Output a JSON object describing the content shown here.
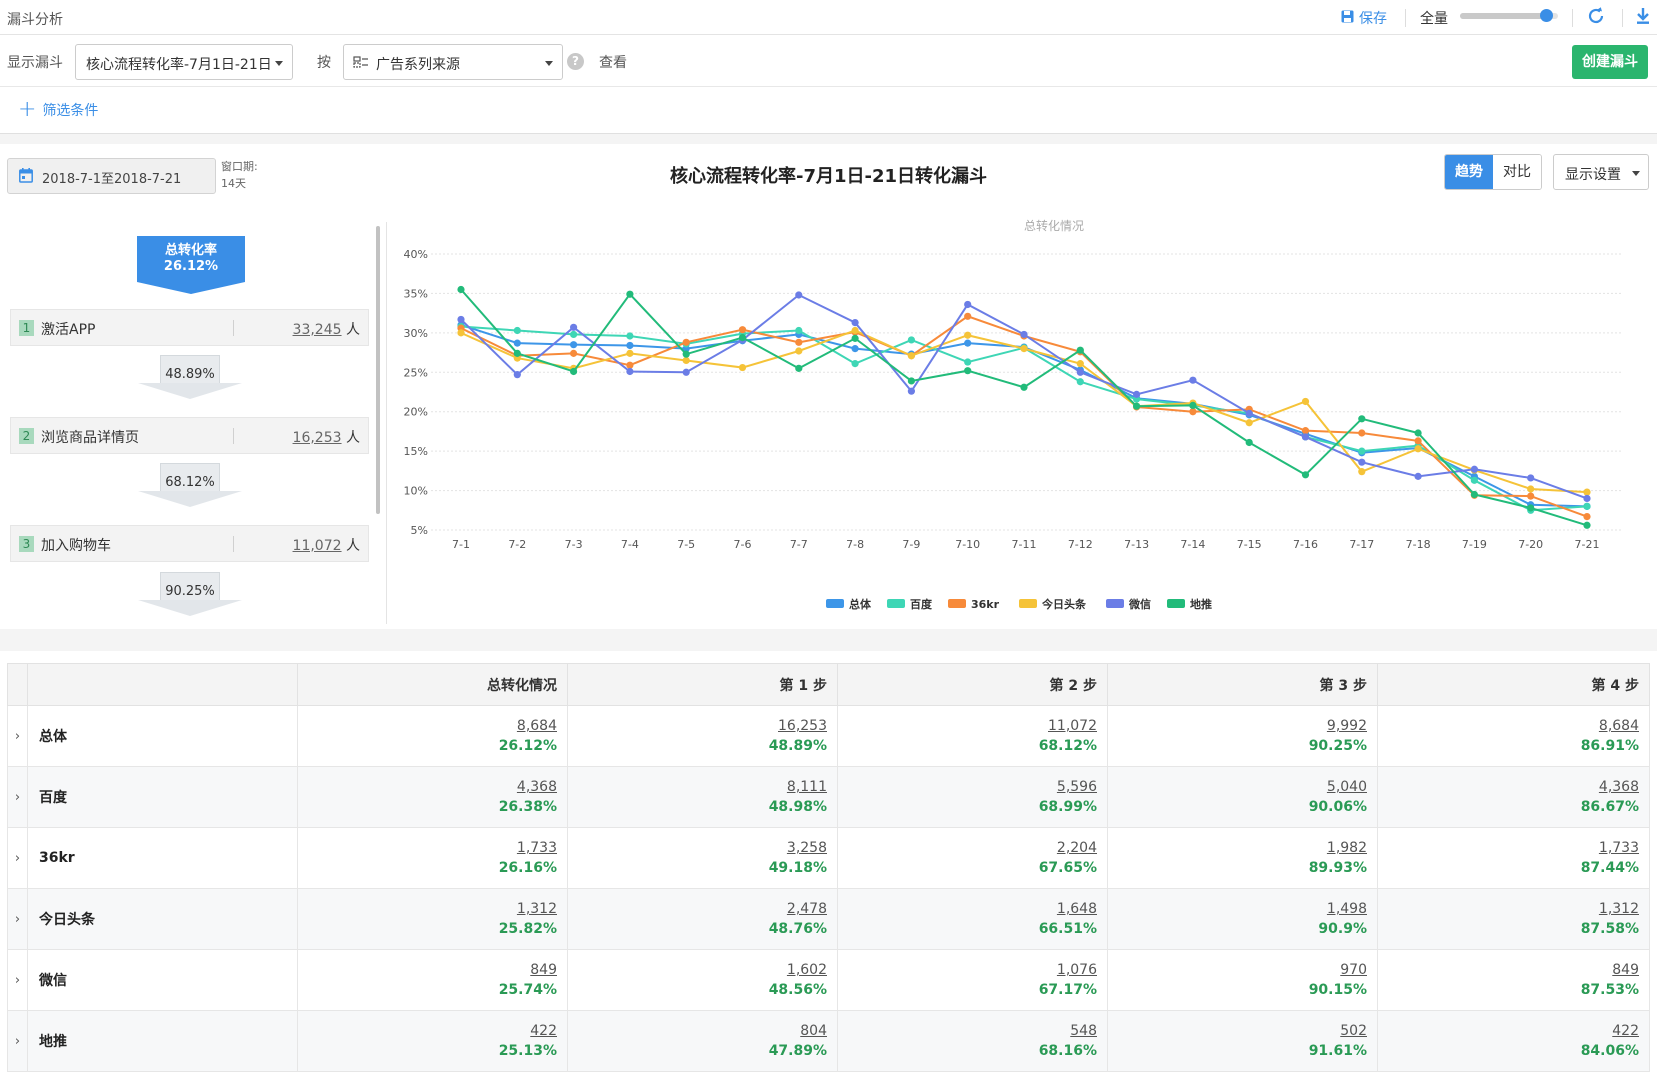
{
  "app": {
    "title": "漏斗分析",
    "save_label": "保存",
    "scope_label": "全量",
    "scope_level": 0.88
  },
  "controls": {
    "show_funnel_label": "显示漏斗",
    "funnel_select": "核心流程转化率-7月1日-21日",
    "by_label": "按",
    "group_select": "广告系列来源",
    "view_label": "查看",
    "create_button": "创建漏斗"
  },
  "filter": {
    "add_label": "筛选条件"
  },
  "panel": {
    "date_range": "2018-7-1至2018-7-21",
    "window_label": "窗口期:",
    "window_value": "14天",
    "title": "核心流程转化率-7月1日-21日转化漏斗",
    "view_tabs": [
      "趋势",
      "对比"
    ],
    "active_tab": "趋势",
    "display_settings": "显示设置"
  },
  "funnel": {
    "total_label": "总转化率",
    "total_value": "26.12%",
    "steps": [
      {
        "num": "1",
        "name": "激活APP",
        "count": "33,245",
        "unit": "人"
      },
      {
        "num": "2",
        "name": "浏览商品详情页",
        "count": "16,253",
        "unit": "人"
      },
      {
        "num": "3",
        "name": "加入购物车",
        "count": "11,072",
        "unit": "人"
      }
    ],
    "conversions": [
      "48.89%",
      "68.12%",
      "90.25%"
    ]
  },
  "chart_data": {
    "type": "line",
    "title": "总转化情况",
    "categories": [
      "7-1",
      "7-2",
      "7-3",
      "7-4",
      "7-5",
      "7-6",
      "7-7",
      "7-8",
      "7-9",
      "7-10",
      "7-11",
      "7-12",
      "7-13",
      "7-14",
      "7-15",
      "7-16",
      "7-17",
      "7-18",
      "7-19",
      "7-20",
      "7-21"
    ],
    "y_ticks": [
      "5%",
      "10%",
      "15%",
      "20%",
      "25%",
      "30%",
      "35%",
      "40%"
    ],
    "ylim": [
      5,
      40
    ],
    "grid": true,
    "legend_position": "bottom",
    "series": [
      {
        "name": "总体",
        "color": "#3d96e8",
        "values": [
          31,
          28.7,
          28.5,
          28.4,
          28,
          29,
          29.8,
          28,
          27.3,
          28.7,
          28.2,
          25.3,
          21.7,
          21,
          19.6,
          17.2,
          14.8,
          15.4,
          11.8,
          8.2,
          8.0
        ]
      },
      {
        "name": "百度",
        "color": "#3ed6b5",
        "values": [
          30.8,
          30.3,
          29.8,
          29.6,
          28.6,
          29.9,
          30.3,
          26.1,
          29.1,
          26.3,
          28.1,
          23.8,
          21.6,
          20.8,
          19.8,
          16.8,
          15.0,
          15.7,
          11.3,
          7.5,
          8.0
        ]
      },
      {
        "name": "36kr",
        "color": "#f78a3a",
        "values": [
          30.6,
          27.1,
          27.4,
          25.9,
          28.8,
          30.4,
          28.8,
          30.1,
          27.1,
          32.1,
          29.6,
          27.6,
          20.6,
          20.0,
          20.3,
          17.6,
          17.3,
          16.3,
          9.4,
          9.3,
          6.7
        ]
      },
      {
        "name": "今日头条",
        "color": "#f5c338",
        "values": [
          30.0,
          26.8,
          25.5,
          27.4,
          26.5,
          25.6,
          27.7,
          30.3,
          27.1,
          29.7,
          28.0,
          26.1,
          20.7,
          21.1,
          18.6,
          21.3,
          12.4,
          15.3,
          12.6,
          10.2,
          9.8
        ]
      },
      {
        "name": "微信",
        "color": "#6b7de6",
        "values": [
          31.7,
          24.7,
          30.7,
          25.1,
          25.0,
          29.1,
          34.8,
          31.3,
          22.6,
          33.6,
          29.8,
          25.0,
          22.2,
          24.0,
          19.8,
          16.8,
          13.6,
          11.8,
          12.7,
          11.6,
          9.0
        ]
      },
      {
        "name": "地推",
        "color": "#22bb7a",
        "values": [
          35.5,
          27.4,
          25.1,
          34.9,
          27.3,
          29.4,
          25.5,
          29.3,
          23.9,
          25.2,
          23.1,
          27.8,
          20.7,
          20.8,
          16.1,
          12.0,
          19.1,
          17.3,
          9.5,
          7.8,
          5.6
        ]
      }
    ]
  },
  "table": {
    "columns": [
      "",
      "",
      "总转化情况",
      "第 1 步",
      "第 2 步",
      "第 3 步",
      "第 4 步"
    ],
    "rows": [
      {
        "name": "总体",
        "cells": [
          [
            "8,684",
            "26.12%"
          ],
          [
            "16,253",
            "48.89%"
          ],
          [
            "11,072",
            "68.12%"
          ],
          [
            "9,992",
            "90.25%"
          ],
          [
            "8,684",
            "86.91%"
          ]
        ]
      },
      {
        "name": "百度",
        "cells": [
          [
            "4,368",
            "26.38%"
          ],
          [
            "8,111",
            "48.98%"
          ],
          [
            "5,596",
            "68.99%"
          ],
          [
            "5,040",
            "90.06%"
          ],
          [
            "4,368",
            "86.67%"
          ]
        ]
      },
      {
        "name": "36kr",
        "cells": [
          [
            "1,733",
            "26.16%"
          ],
          [
            "3,258",
            "49.18%"
          ],
          [
            "2,204",
            "67.65%"
          ],
          [
            "1,982",
            "89.93%"
          ],
          [
            "1,733",
            "87.44%"
          ]
        ]
      },
      {
        "name": "今日头条",
        "cells": [
          [
            "1,312",
            "25.82%"
          ],
          [
            "2,478",
            "48.76%"
          ],
          [
            "1,648",
            "66.51%"
          ],
          [
            "1,498",
            "90.9%"
          ],
          [
            "1,312",
            "87.58%"
          ]
        ]
      },
      {
        "name": "微信",
        "cells": [
          [
            "849",
            "25.74%"
          ],
          [
            "1,602",
            "48.56%"
          ],
          [
            "1,076",
            "67.17%"
          ],
          [
            "970",
            "90.15%"
          ],
          [
            "849",
            "87.53%"
          ]
        ]
      },
      {
        "name": "地推",
        "cells": [
          [
            "422",
            "25.13%"
          ],
          [
            "804",
            "47.89%"
          ],
          [
            "548",
            "68.16%"
          ],
          [
            "502",
            "91.61%"
          ],
          [
            "422",
            "84.06%"
          ]
        ]
      }
    ]
  }
}
